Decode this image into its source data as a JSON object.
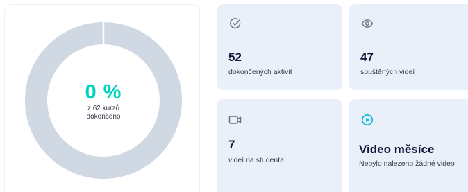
{
  "progress": {
    "percent_label": "0 %",
    "percent_value": 0,
    "courses_line": "z 62 kurzů",
    "completed_line": "dokončeno",
    "ring_color": "#cfd8e3",
    "fill_color": "#00d2c0"
  },
  "stats": {
    "activities": {
      "icon": "check-circle-icon",
      "value": "52",
      "label": "dokončených aktivit"
    },
    "videos": {
      "icon": "eye-icon",
      "value": "47",
      "label": "spuštěných videí"
    },
    "per_student": {
      "icon": "video-camera-icon",
      "value": "7",
      "label": "videí na studenta"
    },
    "video_month": {
      "icon": "play-circle-icon",
      "title": "Video měsíce",
      "text": "Nebylo nalezeno žádné video"
    }
  },
  "colors": {
    "card_background": "#e9f0fa",
    "accent": "#00d2c0",
    "heading": "#14163a",
    "icon_gray": "#6b6f80"
  }
}
